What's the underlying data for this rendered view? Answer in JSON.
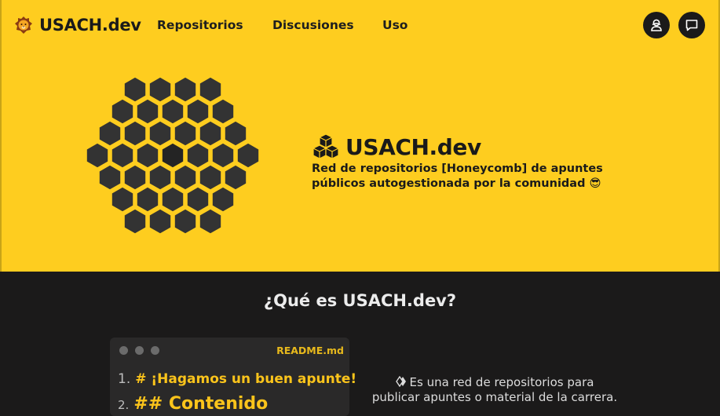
{
  "nav": {
    "brand": "USACH.dev",
    "links": [
      "Repositorios",
      "Discusiones",
      "Uso"
    ],
    "icons": {
      "brand": "lion-icon",
      "account": "user-icon",
      "chat": "chat-icon"
    }
  },
  "hero": {
    "title": "USACH.dev",
    "description_line1": "Red de repositorios [Honeycomb] de apuntes",
    "description_line2": "públicos autogestionada por la comunidad 😎",
    "icon": "cubes-icon",
    "colors": {
      "background": "#fecd1f",
      "hex": "#333333",
      "hex_center": "#242424"
    }
  },
  "about": {
    "heading": "¿Qué es USACH.dev?",
    "editor": {
      "filename": "README.md",
      "lines": [
        {
          "num": "1.",
          "text": "# ¡Hagamos un buen apunte!"
        },
        {
          "num": "2.",
          "text": "## Contenido"
        }
      ]
    },
    "text_line1": "Es una red de repositorios para",
    "text_line2": "publicar apuntes o material de la carrera.",
    "icon": "graph-icon"
  },
  "colors": {
    "dark_bg": "#1b1a1a",
    "accent": "#fbc41b"
  }
}
